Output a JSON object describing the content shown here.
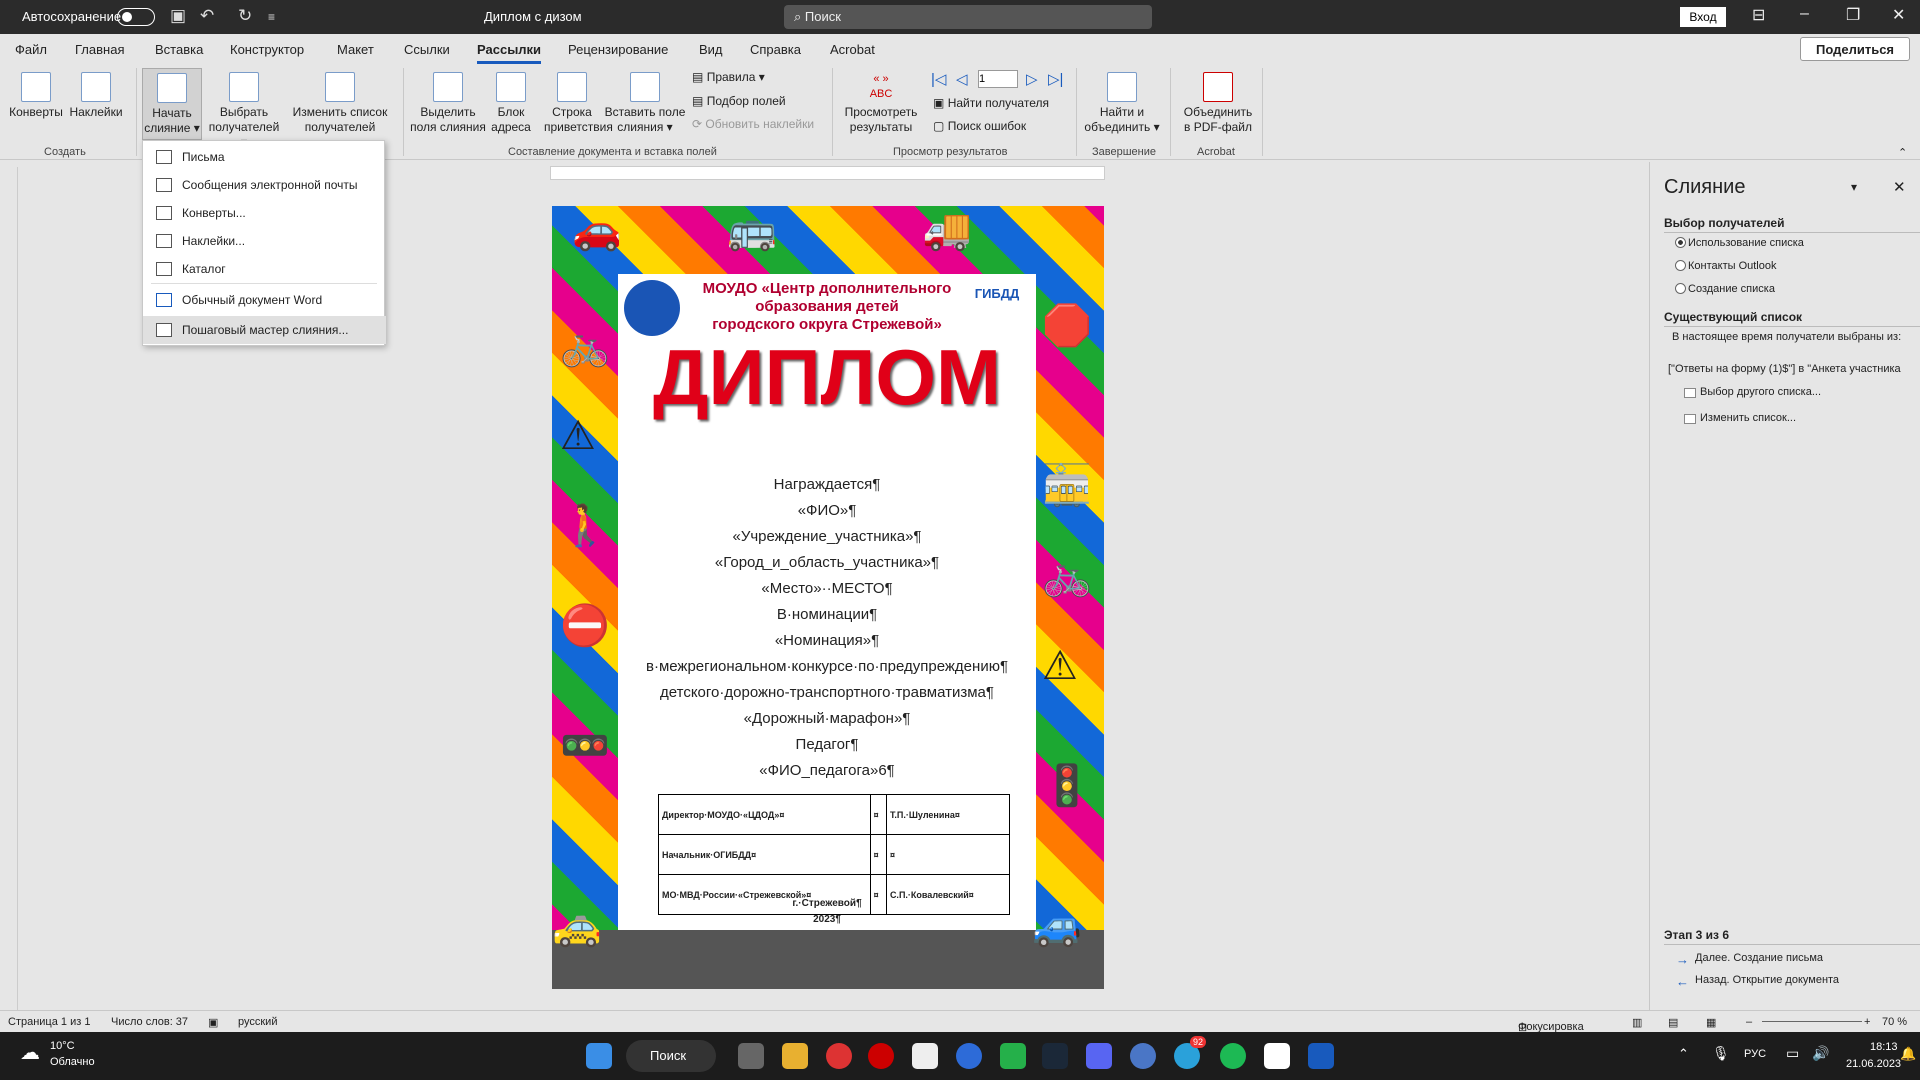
{
  "titlebar": {
    "autosave": "Автосохранение",
    "doc_title": "Диплом с дизом",
    "search": "Поиск",
    "login": "Вход"
  },
  "tabs": [
    "Файл",
    "Главная",
    "Вставка",
    "Конструктор",
    "Макет",
    "Ссылки",
    "Рассылки",
    "Рецензирование",
    "Вид",
    "Справка",
    "Acrobat"
  ],
  "share": "Поделиться",
  "ribbon": {
    "envelopes": "Конверты",
    "labels": "Наклейки",
    "start": "Начать",
    "start2": "слияние",
    "select": "Выбрать",
    "select2": "получателей",
    "edit": "Изменить список",
    "edit2": "получателей",
    "highlight": "Выделить",
    "highlight2": "поля слияния",
    "block": "Блок",
    "block2": "адреса",
    "greet": "Строка",
    "greet2": "приветствия",
    "insert": "Вставить поле",
    "insert2": "слияния",
    "rules": "Правила",
    "match": "Подбор полей",
    "update": "Обновить наклейки",
    "preview": "Просмотреть",
    "preview2": "результаты",
    "record": "1",
    "find": "Найти получателя",
    "check": "Поиск ошибок",
    "finish": "Найти и",
    "finish2": "объединить",
    "pdf": "Объединить",
    "pdf2": "в PDF-файл",
    "g_create": "Создать",
    "g_write": "Составление документа и вставка полей",
    "g_preview": "Просмотр результатов",
    "g_finish": "Завершение",
    "g_acrobat": "Acrobat"
  },
  "dropdown": [
    "Письма",
    "Сообщения электронной почты",
    "Конверты...",
    "Наклейки...",
    "Каталог",
    "Обычный документ Word",
    "Пошаговый мастер слияния..."
  ],
  "document": {
    "org1": "МОУДО «Центр дополнительного",
    "org2": "образования детей",
    "org3": "городского округа Стрежевой»",
    "title": "ДИПЛОМ",
    "lines": [
      "Награждается¶",
      "«ФИО»¶",
      "«Учреждение_участника»¶",
      "«Город_и_область_участника»¶",
      "«Место»··МЕСТО¶",
      "В·номинации¶",
      "«Номинация»¶",
      "в·межрегиональном·конкурсе·по·предупреждению¶",
      "детского·дорожно-транспортного·травматизма¶",
      "«Дорожный·марафон»¶",
      "Педагог¶",
      "«ФИО_педагога»6¶"
    ],
    "sig": [
      [
        "Директор·МОУДО·«ЦДОД»¤",
        "¤",
        "Т.П.·Шуленина¤"
      ],
      [
        "Начальник·ОГИБДД¤",
        "¤",
        "¤"
      ],
      [
        "МО·МВД·России·«Стрежевской»¤",
        "¤",
        "С.П.·Ковалевский¤"
      ]
    ],
    "city": "г.·Стрежевой¶",
    "year": "2023¶",
    "gibdd": "ГИБДД"
  },
  "merge": {
    "title": "Слияние",
    "s1": "Выбор получателей",
    "opts": [
      "Использование списка",
      "Контакты Outlook",
      "Создание списка"
    ],
    "s2": "Существующий список",
    "desc": "В настоящее время получатели выбраны из:",
    "src": "[\"Ответы на форму (1)$\"] в \"Анкета участника",
    "l1": "Выбор другого списка...",
    "l2": "Изменить список...",
    "step": "Этап 3 из 6",
    "next": "Далее. Создание письма",
    "back": "Назад. Открытие документа"
  },
  "status": {
    "page": "Страница 1 из 1",
    "words": "Число слов: 37",
    "lang": "русский",
    "focus": "Фокусировка",
    "zoom": "70 %"
  },
  "taskbar": {
    "temp": "10°C",
    "weather": "Облачно",
    "search": "Поиск",
    "lang": "РУС",
    "time": "18:13",
    "date": "21.06.2023",
    "badge": "92"
  }
}
